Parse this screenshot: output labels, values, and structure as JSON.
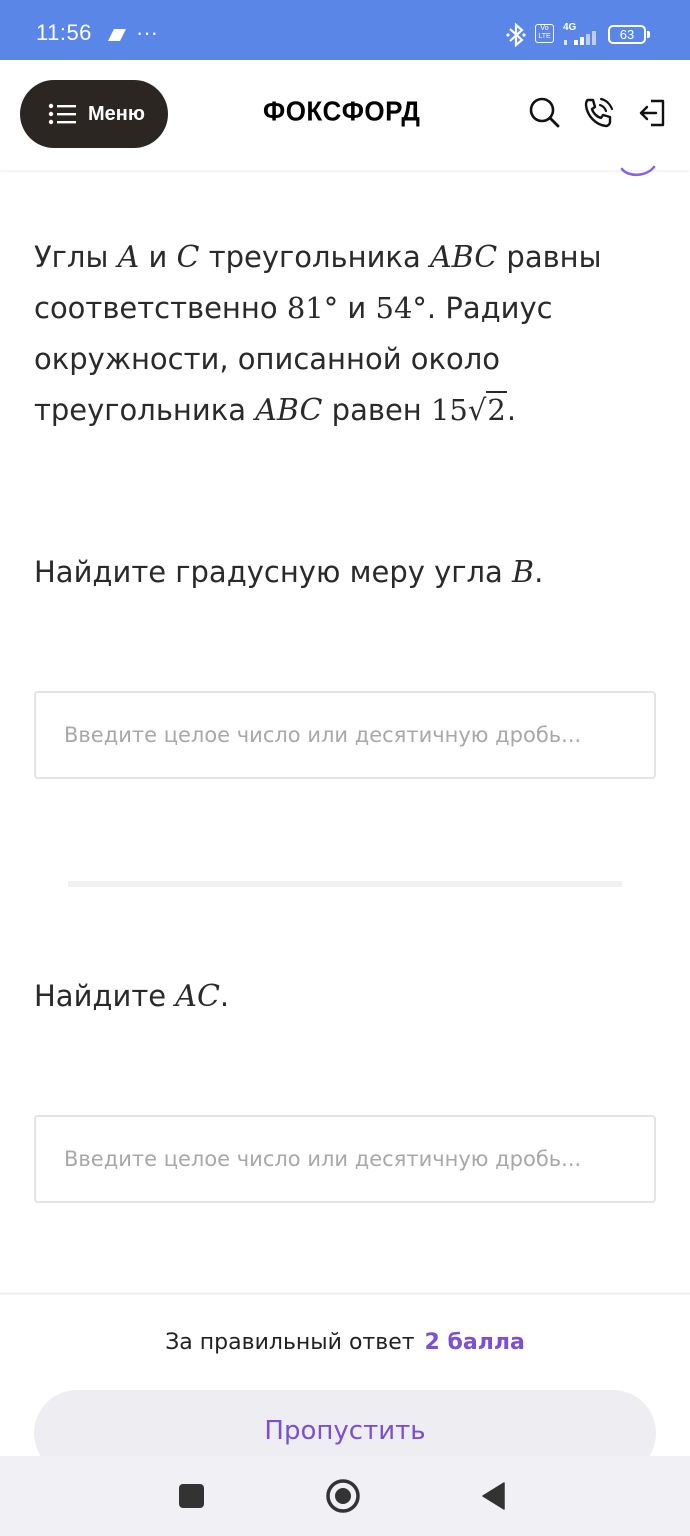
{
  "status_bar": {
    "time": "11:56",
    "dots": "···",
    "volte": "Vo\nLTE",
    "network": "4G",
    "battery": "63",
    "color": "#5a86e8"
  },
  "header": {
    "menu_label": "Меню",
    "logo": "ФОКСФОРД"
  },
  "problem": {
    "s1": "Углы ",
    "A": "A",
    "and1": " и ",
    "C": "C",
    "s2": " треугольника ",
    "ABC1": "ABC",
    "s3": " равны соответственно ",
    "angle_a": "81°",
    "and2": " и ",
    "angle_c": "54°",
    "s4": ". Радиус окружности, описанной около треугольника ",
    "ABC2": "ABC",
    "s5": " равен ",
    "r_coef": "15",
    "r_sqrt_sign": "√",
    "r_sqrt_arg": "2",
    "s6": "."
  },
  "question1": {
    "text": "Найдите градусную меру угла ",
    "var": "B",
    "end": ".",
    "placeholder": "Введите целое число или десятичную дробь..."
  },
  "question2": {
    "text": "Найдите ",
    "var": "AC",
    "end": ".",
    "placeholder": "Введите целое число или десятичную дробь..."
  },
  "footer": {
    "score_label": "За правильный ответ",
    "score_value": "2 балла",
    "skip_label": "Пропустить",
    "accent_color": "#7b4fd6"
  }
}
